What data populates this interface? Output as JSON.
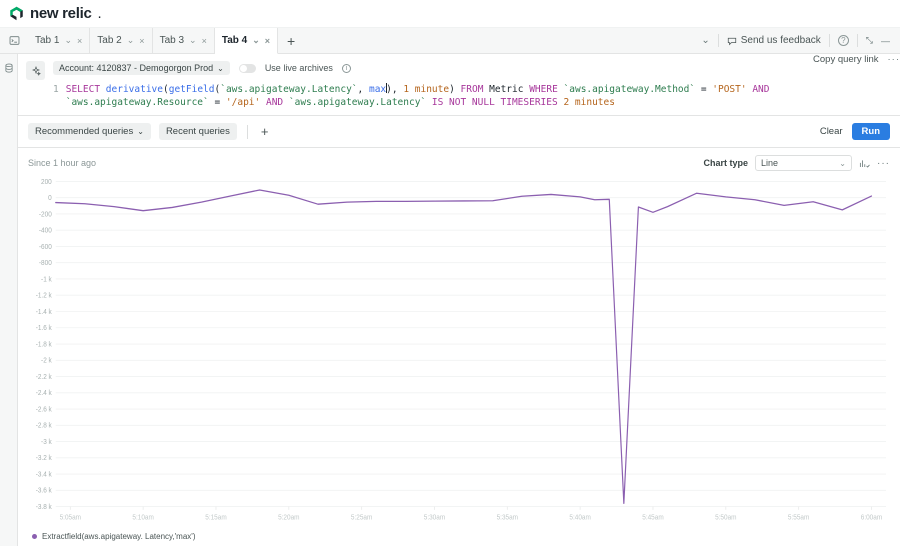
{
  "brand": {
    "name": "new relic",
    "trademark": "."
  },
  "tabs": {
    "items": [
      {
        "label": "Tab 1",
        "active": false
      },
      {
        "label": "Tab 2",
        "active": false
      },
      {
        "label": "Tab 3",
        "active": false
      },
      {
        "label": "Tab 4",
        "active": true
      }
    ],
    "add_label": "+",
    "chevron": "⌄",
    "close": "×"
  },
  "topbar": {
    "collapse_chevron": "⌄",
    "feedback_label": "Send us feedback",
    "help_label": "?",
    "expand_label": "⤡",
    "minimize_label": "—"
  },
  "editor": {
    "account_label": "Account: 4120837 - Demogorgon Prod",
    "account_chevron": "⌄",
    "live_archives_label": "Use live archives",
    "info_label": "i",
    "copy_query_link": "Copy query link",
    "more_label": "···",
    "line_number": "1",
    "query_text": "SELECT derivative(getField(`aws.apigateway.Latency`, max), 1 minute) FROM Metric WHERE `aws.apigateway.Method` = 'POST' AND `aws.apigateway.Resource` = '/api' AND `aws.apigateway.Latency` IS NOT NULL TIMESERIES 2 minutes",
    "tokens": [
      {
        "t": "SELECT",
        "c": "k-kw"
      },
      {
        "t": " ",
        "c": "k-plain"
      },
      {
        "t": "derivative",
        "c": "k-fn"
      },
      {
        "t": "(",
        "c": "k-plain"
      },
      {
        "t": "getField",
        "c": "k-fn"
      },
      {
        "t": "(",
        "c": "k-plain"
      },
      {
        "t": "`aws.apigateway.Latency`",
        "c": "k-fld"
      },
      {
        "t": ", ",
        "c": "k-plain"
      },
      {
        "t": "max",
        "c": "k-agg"
      },
      {
        "t": "CARET",
        "c": "caret"
      },
      {
        "t": "), ",
        "c": "k-plain"
      },
      {
        "t": "1 minute",
        "c": "k-num"
      },
      {
        "t": ") ",
        "c": "k-plain"
      },
      {
        "t": "FROM",
        "c": "k-kw"
      },
      {
        "t": " Metric ",
        "c": "k-plain"
      },
      {
        "t": "WHERE",
        "c": "k-kw"
      },
      {
        "t": " ",
        "c": "k-plain"
      },
      {
        "t": "`aws.apigateway.Method`",
        "c": "k-fld"
      },
      {
        "t": " = ",
        "c": "k-plain"
      },
      {
        "t": "'POST'",
        "c": "k-str"
      },
      {
        "t": " ",
        "c": "k-plain"
      },
      {
        "t": "AND",
        "c": "k-kw"
      },
      {
        "t": " ",
        "c": "k-plain"
      },
      {
        "t": "`aws.apigateway.Resource`",
        "c": "k-fld"
      },
      {
        "t": " = ",
        "c": "k-plain"
      },
      {
        "t": "'/api'",
        "c": "k-str"
      },
      {
        "t": " ",
        "c": "k-plain"
      },
      {
        "t": "AND",
        "c": "k-kw"
      },
      {
        "t": " ",
        "c": "k-plain"
      },
      {
        "t": "`aws.apigateway.Latency`",
        "c": "k-fld"
      },
      {
        "t": " ",
        "c": "k-plain"
      },
      {
        "t": "IS NOT NULL TIMESERIES",
        "c": "k-kw"
      },
      {
        "t": " ",
        "c": "k-plain"
      },
      {
        "t": "2 minutes",
        "c": "k-num"
      }
    ]
  },
  "query_toolbar": {
    "recommended_label": "Recommended queries",
    "recommended_chevron": "⌄",
    "recent_label": "Recent queries",
    "add_label": "+",
    "clear_label": "Clear",
    "run_label": "Run"
  },
  "chart_header": {
    "since_label": "Since 1 hour ago",
    "chart_type_label": "Chart type",
    "chart_type_value": "Line",
    "chart_type_chevron": "⌄",
    "more_label": "···"
  },
  "chart_data": {
    "type": "line",
    "title": "",
    "xlabel": "",
    "ylabel": "",
    "legend": [
      "Extractfield(aws.apigateway. Latency,'max')"
    ],
    "legend_position": "bottom-left",
    "grid": true,
    "series_color": "#8b5fb0",
    "ylim": [
      -3800,
      200
    ],
    "yticks": [
      200,
      0,
      -200,
      -400,
      -600,
      -800,
      -1000,
      -1200,
      -1400,
      -1600,
      -1800,
      -2000,
      -2200,
      -2400,
      -2600,
      -2800,
      -3000,
      -3200,
      -3400,
      -3600,
      -3800
    ],
    "ytick_labels": [
      "200",
      "0",
      "-200",
      "-400",
      "-600",
      "-800",
      "-1 k",
      "-1.2 k",
      "-1.4 k",
      "-1.6 k",
      "-1.8 k",
      "-2 k",
      "-2.2 k",
      "-2.4 k",
      "-2.6 k",
      "-2.8 k",
      "-3 k",
      "-3.2 k",
      "-3.4 k",
      "-3.6 k",
      "-3.8 k"
    ],
    "xtick_labels": [
      "5:05am",
      "5:10am",
      "5:15am",
      "5:20am",
      "5:25am",
      "5:30am",
      "5:35am",
      "5:40am",
      "5:45am",
      "5:50am",
      "5:55am",
      "6:00am"
    ],
    "xlim_minutes": [
      4,
      61
    ],
    "series": [
      {
        "name": "Extractfield(aws.apigateway. Latency,'max')",
        "color": "#8b5fb0",
        "x": [
          4,
          6,
          8,
          10,
          12,
          14,
          16,
          18,
          20,
          22,
          24,
          26,
          28,
          30,
          32,
          34,
          36,
          38,
          40,
          41,
          42,
          43,
          44,
          45,
          46,
          48,
          50,
          52,
          54,
          56,
          58,
          60
        ],
        "values": [
          -60,
          -75,
          -110,
          -160,
          -120,
          -55,
          20,
          95,
          30,
          -80,
          -55,
          -45,
          -45,
          -42,
          -40,
          -38,
          18,
          40,
          10,
          -25,
          -20,
          -3760,
          -115,
          -180,
          -110,
          55,
          10,
          -25,
          -95,
          -50,
          -150,
          20
        ]
      }
    ]
  },
  "left_rail": {
    "data_icon": "database-icon"
  }
}
